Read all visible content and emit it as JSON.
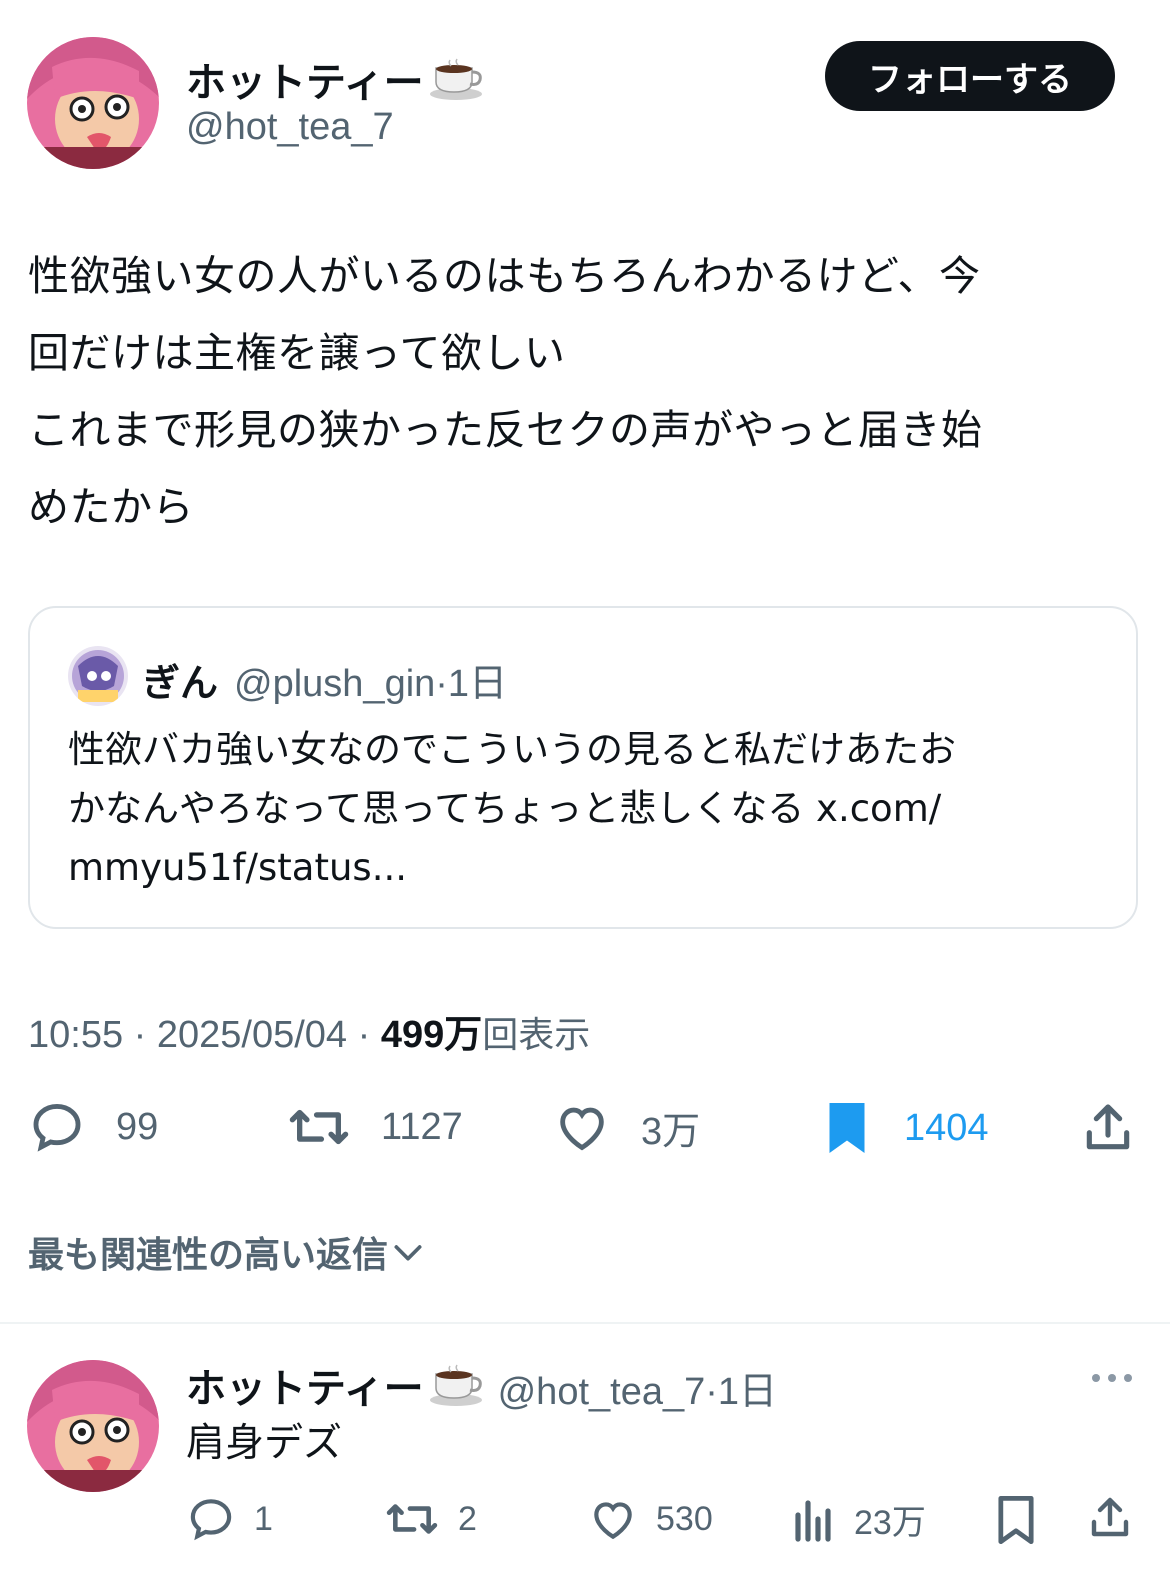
{
  "tweet": {
    "author_name": "ホットティー",
    "author_handle": "@hot_tea_7",
    "follow_label": "フォローする",
    "text": "性欲強い女の人がいるのはもちろんわかるけど、今\n回だけは主権を譲って欲しい\nこれまで形見の狭かった反セクの声がやっと届き始\nめたから",
    "time": "10:55",
    "date": "2025/05/04",
    "views_count": "499万",
    "views_label": "回表示",
    "separator": " · "
  },
  "quote": {
    "author_name": "ぎん",
    "author_handle": "@plush_gin",
    "age": "·1日",
    "text": "性欲バカ強い女なのでこういうの見ると私だけあたお\nかなんやろなって思ってちょっと悲しくなる x.com/\nmmyu51f/status..."
  },
  "actions": {
    "replies": "99",
    "retweets": "1127",
    "likes": "3万",
    "bookmarks": "1404"
  },
  "replies_sort": {
    "label": "最も関連性の高い返信"
  },
  "reply": {
    "author_name": "ホットティー",
    "author_handle": "@hot_tea_7",
    "age": "·1日",
    "text": "肩身デズ",
    "replies": "1",
    "retweets": "2",
    "likes": "530",
    "views": "23万"
  },
  "colors": {
    "text": "#0f1419",
    "secondary": "#536471",
    "accent": "#1d9bf0",
    "avatar_hair": "#e86fa0"
  },
  "icons": [
    "coffee-icon",
    "reply-icon",
    "retweet-icon",
    "like-icon",
    "bookmark-icon",
    "share-icon",
    "chevron-down-icon",
    "more-icon",
    "views-icon"
  ]
}
